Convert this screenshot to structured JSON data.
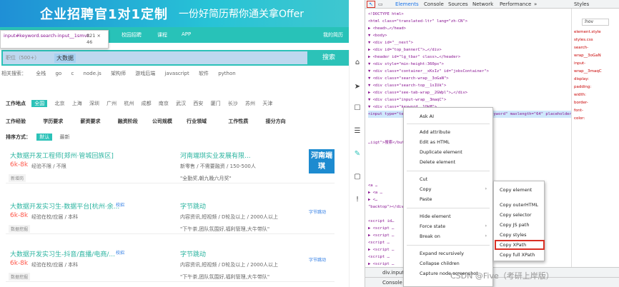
{
  "banner": {
    "headline": "企业招聘官1对1定制",
    "subline": "一份好简历帮你通关拿Offer"
  },
  "nav": {
    "items": [
      "",
      "",
      "校园招聘",
      "课程",
      "APP"
    ],
    "right": "我的简历"
  },
  "tooltip": {
    "selector": "input#keyword.search-input__1smvz",
    "size": "821 × 46"
  },
  "search": {
    "scope": "职位（500+）",
    "keyword": "大数据",
    "button": "搜索"
  },
  "hot": {
    "label": "相关搜索：",
    "items": [
      "全栈",
      "go",
      "c",
      "node.js",
      "架构师",
      "游戏后端",
      "javascript",
      "软件",
      "python"
    ]
  },
  "filters": {
    "city_label": "工作地点",
    "cities": [
      "全国",
      "北京",
      "上海",
      "深圳",
      "广州",
      "杭州",
      "成都",
      "南京",
      "武汉",
      "西安",
      "厦门",
      "长沙",
      "苏州",
      "天津"
    ],
    "row2": [
      "工作经验",
      "学历要求",
      "薪资要求",
      "融资阶段",
      "公司规模",
      "行业领域",
      "工作性质",
      "接分方向"
    ],
    "sort_label": "排序方式：",
    "sort": [
      "默认",
      "最新"
    ]
  },
  "jobs": [
    {
      "title": "大数据开发工程师[郑州·管城回族区]",
      "salary": "6k-8k",
      "req": "经验不限 / 不限",
      "tag": "新增岗",
      "company": "河南端琪实业发展有限...",
      "info": "新零售 / 不需要融资 / 150-500人",
      "welfare": "\"全勤奖,朝九晚六月奖\"",
      "logo": "河南端琪"
    },
    {
      "title": "大数据开发实习生-数据平台[杭州·余...",
      "badge": "校招",
      "salary": "6k-8k",
      "req": "经验在校/应届 / 本科",
      "tag": "数据挖掘",
      "company": "字节跳动",
      "info": "内容资讯,短视频 / D轮及以上 / 2000人以上",
      "welfare": "\"下午茶,团队氛围好,福利管理,大牛带队\"",
      "logo": "字节跳动"
    },
    {
      "title": "大数据开发实习生-抖音/直播/电商/...",
      "badge": "校招",
      "salary": "6k-8k",
      "req": "经验在校/应届 / 本科",
      "tag": "数据挖掘",
      "company": "字节跳动",
      "info": "内容资讯,短视频 / D轮及以上 / 2000人以上",
      "welfare": "\"下午茶,团队氛围好,福利管理,大牛带队\"",
      "logo": "字节跳动"
    }
  ],
  "devtools": {
    "tabs": [
      "Elements",
      "Console",
      "Sources",
      "Network",
      "Performance",
      "»"
    ],
    "styles_tab": "Styles",
    "filter": ":hov",
    "breadcrumb": "div.input-...   input#keyword.search-input",
    "console_tab": "Console",
    "lines": [
      "<!DOCTYPE html>",
      "<html class=\"translated-ltr\" lang=\"zh-CN\">",
      "▶ <head>…</head>",
      "▼ <body>",
      "  ▼ <div id=\"__next\">",
      "    ▶ <div id=\"top_bannerC\">…</div>",
      "    ▶ <header id=\"lg_tbar\" class>…</header>",
      "    ▼ <div style=\"min-height:360px\">",
      "      ▼ <div class=\"container__xKsIz\" id=\"jobsContainer\">",
      "        ▼ <div class=\"search-wrap__3oGaN\">",
      "          ▼ <div class=\"search-top__1sIUk\">",
      "            ▶ <div class=\"see-tab-wrap__2GWpl\">…</div>",
      "            ▼ <div class=\"input-wrap__3maqC\">",
      "              ▼ <div class=\"keyword__1OkM\">",
      "                <input type=\"text\" class=\"search-input__1smvz\" id=\"keyword\" maxlength=\"64\" placeholder=\"搜索职位、公司或地点\" value=\"大数据\">",
      "",
      "",
      "",
      "                …iigt\">搜索</button>",
      "",
      "",
      "",
      "",
      "",
      "          <a …",
      "            ▶ <a …",
      "            ▶ <…",
      "              \"backtop\"></div>",
      "",
      "        <script id…",
      "        ▶ <script …",
      "        ▶ <script …",
      "        <script …",
      "        ▶ <script …",
      "        <script …",
      "        ▶ <script …",
      "        <script …"
    ],
    "styles_lines": [
      "element.style",
      "styles.css",
      "search-",
      "wrap__3oGaN",
      "input-",
      "wrap__3maqC",
      "display:",
      "padding:",
      "width:",
      "border-",
      "font-",
      "color:"
    ]
  },
  "context_menu": [
    "Ask AI",
    "Add attribute",
    "Edit as HTML",
    "Duplicate element",
    "Delete element",
    "Cut",
    "Copy",
    "Paste",
    "Hide element",
    "Force state",
    "Break on",
    "Expand recursively",
    "Collapse children",
    "Capture node screenshot"
  ],
  "copy_submenu": [
    "Copy element",
    "Copy outerHTML",
    "Copy selector",
    "Copy JS path",
    "Copy styles",
    "Copy XPath",
    "Copy full XPath"
  ],
  "watermark": "CSDN @Five（考研上岸版）"
}
